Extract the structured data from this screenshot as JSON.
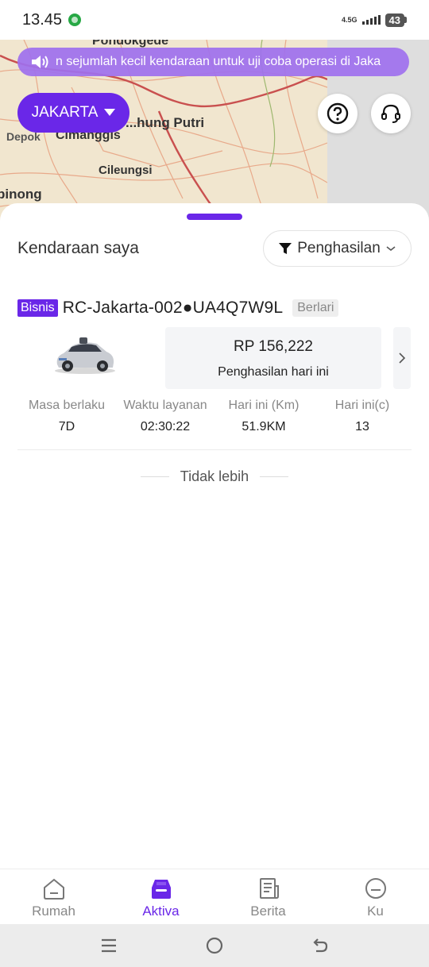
{
  "status_bar": {
    "time": "13.45",
    "network": "4.5G",
    "battery": "43"
  },
  "map": {
    "labels": [
      "Pondokgede",
      "Depok",
      "Cimanggis",
      "...hung Putri",
      "Cileungsi",
      "binong"
    ]
  },
  "announcement": {
    "text": "n sejumlah kecil kendaraan untuk uji coba operasi di Jaka",
    "icon": "speaker-icon"
  },
  "city_selector": {
    "label": "JAKARTA",
    "icon": "caret-down-icon"
  },
  "top_actions": {
    "help_icon": "question-circle-icon",
    "support_icon": "headset-icon"
  },
  "section": {
    "title": "Kendaraan saya",
    "filter_label": "Penghasilan",
    "filter_icon": "funnel-icon"
  },
  "vehicle": {
    "tag": "Bisnis",
    "name": "RC-Jakarta-002●UA4Q7W9L",
    "status": "Berlari",
    "earnings_value": "RP 156,222",
    "earnings_label": "Penghasilan hari ini",
    "stats": [
      {
        "label": "Masa berlaku",
        "value": "7D"
      },
      {
        "label": "Waktu layanan",
        "value": "02:30:22"
      },
      {
        "label": "Hari ini (Km)",
        "value": "51.9KM"
      },
      {
        "label": "Hari ini(c)",
        "value": "13"
      }
    ]
  },
  "list_end": {
    "text": "Tidak lebih"
  },
  "bottom_nav": {
    "items": [
      {
        "label": "Rumah",
        "icon": "home-icon",
        "active": false
      },
      {
        "label": "Aktiva",
        "icon": "car-icon",
        "active": true
      },
      {
        "label": "Berita",
        "icon": "news-icon",
        "active": false
      },
      {
        "label": "Ku",
        "icon": "profile-icon",
        "active": false
      }
    ]
  },
  "colors": {
    "accent": "#6a27e8",
    "announcement_bg": "#9e70ee",
    "map_bg": "#f1e6cf",
    "muted_text": "#888888"
  }
}
